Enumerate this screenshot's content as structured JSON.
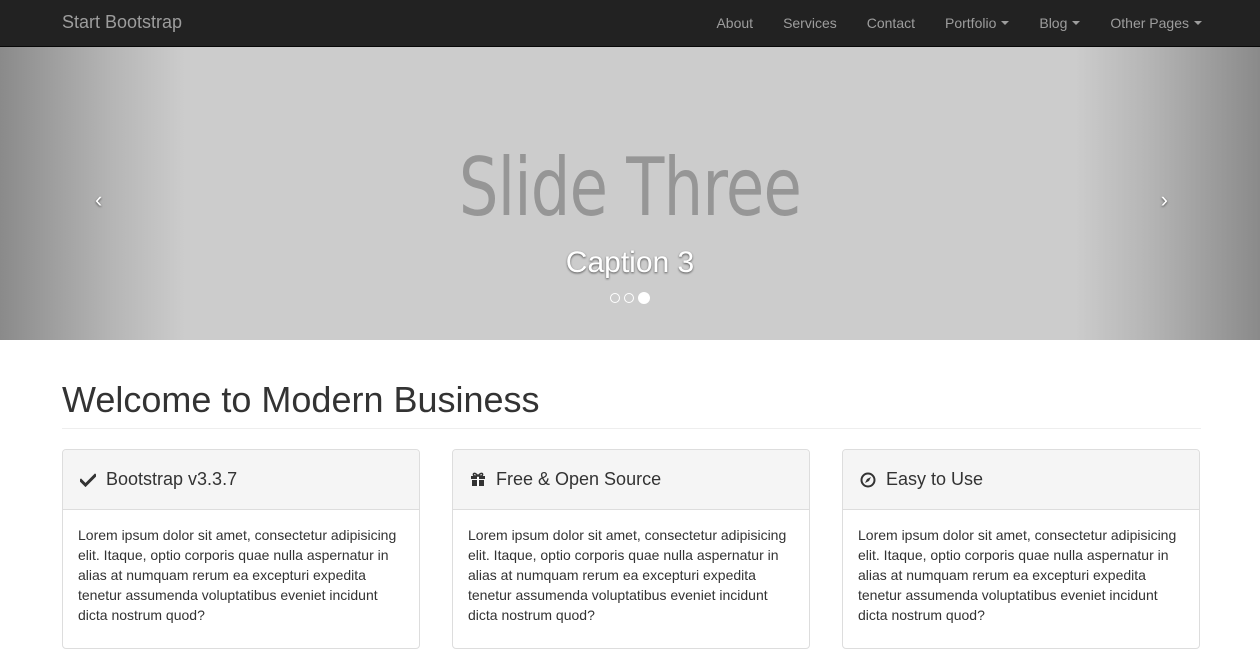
{
  "navbar": {
    "brand": "Start Bootstrap",
    "items": [
      {
        "label": "About",
        "dropdown": false
      },
      {
        "label": "Services",
        "dropdown": false
      },
      {
        "label": "Contact",
        "dropdown": false
      },
      {
        "label": "Portfolio",
        "dropdown": true
      },
      {
        "label": "Blog",
        "dropdown": true
      },
      {
        "label": "Other Pages",
        "dropdown": true
      }
    ]
  },
  "carousel": {
    "slide_title": "Slide Three",
    "caption": "Caption 3",
    "prev_glyph": "‹",
    "next_glyph": "›",
    "indicator_count": 3,
    "active_index": 2
  },
  "main": {
    "heading": "Welcome to Modern Business",
    "panels": [
      {
        "icon": "check-icon",
        "title": "Bootstrap v3.3.7",
        "body": "Lorem ipsum dolor sit amet, consectetur adipisicing elit. Itaque, optio corporis quae nulla aspernatur in alias at numquam rerum ea excepturi expedita tenetur assumenda voluptatibus eveniet incidunt dicta nostrum quod?"
      },
      {
        "icon": "gift-icon",
        "title": "Free & Open Source",
        "body": "Lorem ipsum dolor sit amet, consectetur adipisicing elit. Itaque, optio corporis quae nulla aspernatur in alias at numquam rerum ea excepturi expedita tenetur assumenda voluptatibus eveniet incidunt dicta nostrum quod?"
      },
      {
        "icon": "compass-icon",
        "title": "Easy to Use",
        "body": "Lorem ipsum dolor sit amet, consectetur adipisicing elit. Itaque, optio corporis quae nulla aspernatur in alias at numquam rerum ea excepturi expedita tenetur assumenda voluptatibus eveniet incidunt dicta nostrum quod?"
      }
    ]
  }
}
